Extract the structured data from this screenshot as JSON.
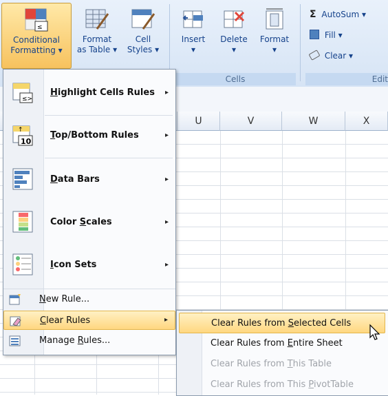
{
  "ribbon": {
    "conditional_formatting": {
      "line1": "Conditional",
      "line2": "Formatting ▾"
    },
    "format_as_table": {
      "line1": "Format",
      "line2": "as Table ▾"
    },
    "cell_styles": {
      "line1": "Cell",
      "line2": "Styles ▾"
    },
    "insert": {
      "label": "Insert",
      "arrow": "▾"
    },
    "delete": {
      "label": "Delete",
      "arrow": "▾"
    },
    "format": {
      "label": "Format",
      "arrow": "▾"
    },
    "cells_group_label": "Cells",
    "autosum": {
      "symbol": "Σ",
      "label": "AutoSum ▾"
    },
    "fill": {
      "label": "Fill ▾"
    },
    "clear": {
      "label": "Clear ▾"
    },
    "editing_group_label_partial": "Edit"
  },
  "grid": {
    "columns": [
      "U",
      "V",
      "W",
      "X"
    ]
  },
  "menu": {
    "items": [
      {
        "pre": "",
        "key": "H",
        "post": "ighlight Cells Rules",
        "icon": "highlight-cells-icon",
        "arrow": "▸"
      },
      {
        "pre": "",
        "key": "T",
        "post": "op/Bottom Rules",
        "icon": "top-bottom-icon",
        "arrow": "▸"
      },
      {
        "pre": "",
        "key": "D",
        "post": "ata Bars",
        "icon": "data-bars-icon",
        "arrow": "▸"
      },
      {
        "pre": "Color ",
        "key": "S",
        "post": "cales",
        "icon": "color-scales-icon",
        "arrow": "▸"
      },
      {
        "pre": "",
        "key": "I",
        "post": "con Sets",
        "icon": "icon-sets-icon",
        "arrow": "▸"
      }
    ],
    "new_rule": {
      "pre": "",
      "key": "N",
      "post": "ew Rule..."
    },
    "clear_rules": {
      "pre": "",
      "key": "C",
      "post": "lear Rules",
      "arrow": "▸"
    },
    "manage_rules": {
      "pre": "Manage ",
      "key": "R",
      "post": "ules..."
    }
  },
  "submenu": {
    "items": [
      {
        "pre": "Clear Rules from ",
        "key": "S",
        "post": "elected Cells",
        "enabled": true,
        "highlighted": true
      },
      {
        "pre": "Clear Rules from ",
        "key": "E",
        "post": "ntire Sheet",
        "enabled": true,
        "highlighted": false
      },
      {
        "pre": "Clear Rules from ",
        "key": "T",
        "post": "his Table",
        "enabled": false,
        "highlighted": false
      },
      {
        "pre": "Clear Rules from This ",
        "key": "P",
        "post": "ivotTable",
        "enabled": false,
        "highlighted": false
      }
    ]
  },
  "colors": {
    "accent_highlight": "#ffd780",
    "ribbon_text": "#15428b",
    "disabled_text": "#a0a4aa"
  }
}
